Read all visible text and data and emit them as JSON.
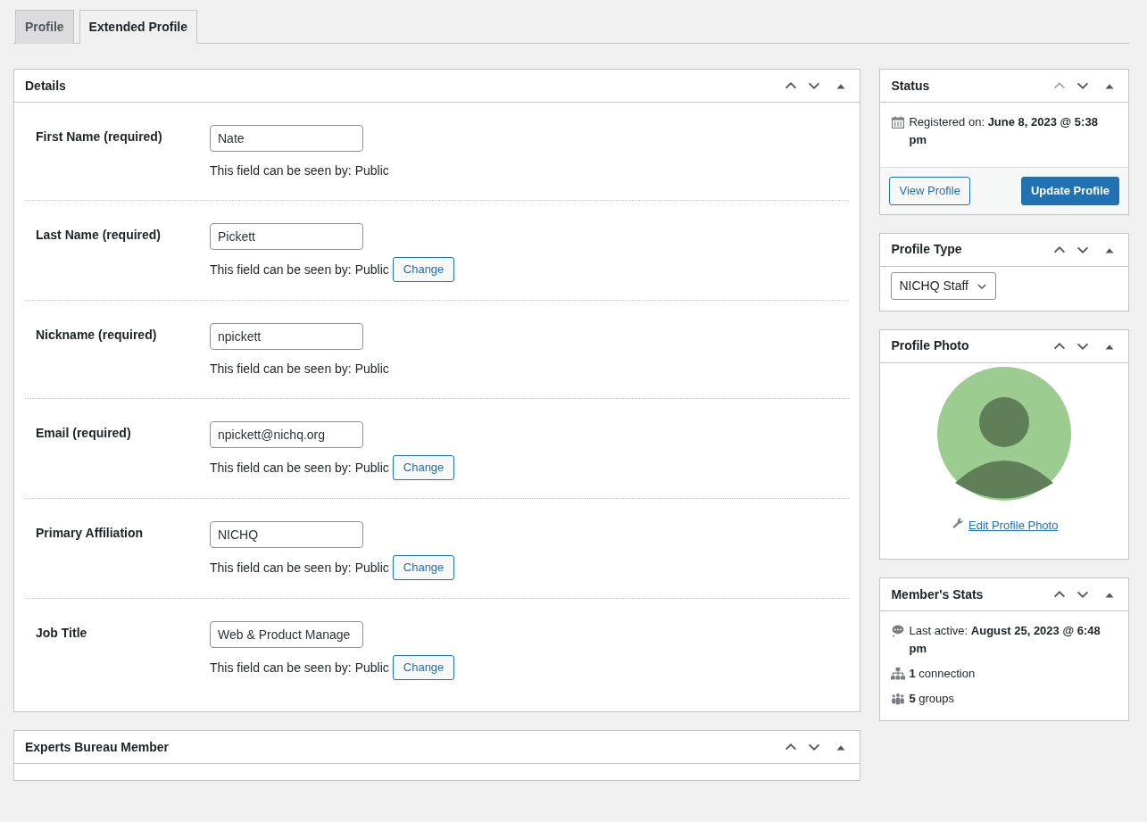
{
  "tabs": [
    {
      "label": "Profile",
      "selected": false
    },
    {
      "label": "Extended Profile",
      "selected": true
    }
  ],
  "details": {
    "title": "Details",
    "up_disabled": false,
    "fields": [
      {
        "label": "First Name (required)",
        "value": "Nate",
        "visibility": "This field can be seen by: Public"
      },
      {
        "label": "Last Name (required)",
        "value": "Pickett",
        "visibility": "This field can be seen by: Public",
        "change": "Change"
      },
      {
        "label": "Nickname (required)",
        "value": "npickett",
        "visibility": "This field can be seen by: Public"
      },
      {
        "label": "Email (required)",
        "value": "npickett@nichq.org",
        "visibility": "This field can be seen by: Public",
        "change": "Change"
      },
      {
        "label": "Primary Affiliation",
        "value": "NICHQ",
        "visibility": "This field can be seen by: Public",
        "change": "Change"
      },
      {
        "label": "Job Title",
        "value": "Web & Product Manage",
        "visibility": "This field can be seen by: Public",
        "change": "Change"
      }
    ]
  },
  "experts": {
    "title": "Experts Bureau Member",
    "up_disabled": false
  },
  "status": {
    "title": "Status",
    "up_disabled": true,
    "registered": "Registered on: **June 8, 2023 @ 5:38 pm**",
    "view_button": "View Profile",
    "update_button": "Update Profile"
  },
  "profile_type": {
    "title": "Profile Type",
    "up_disabled": false,
    "value": "NICHQ Staff"
  },
  "profile_photo": {
    "title": "Profile Photo",
    "up_disabled": false,
    "edit_link": "Edit Profile Photo"
  },
  "stats": {
    "title": "Member's Stats",
    "up_disabled": false,
    "items": [
      {
        "kind": "activity",
        "text": "Last active: **August 25, 2023 @ 6:48 pm**"
      },
      {
        "kind": "connections",
        "text": "**1** connection"
      },
      {
        "kind": "groups",
        "text": "**5** groups"
      }
    ]
  }
}
